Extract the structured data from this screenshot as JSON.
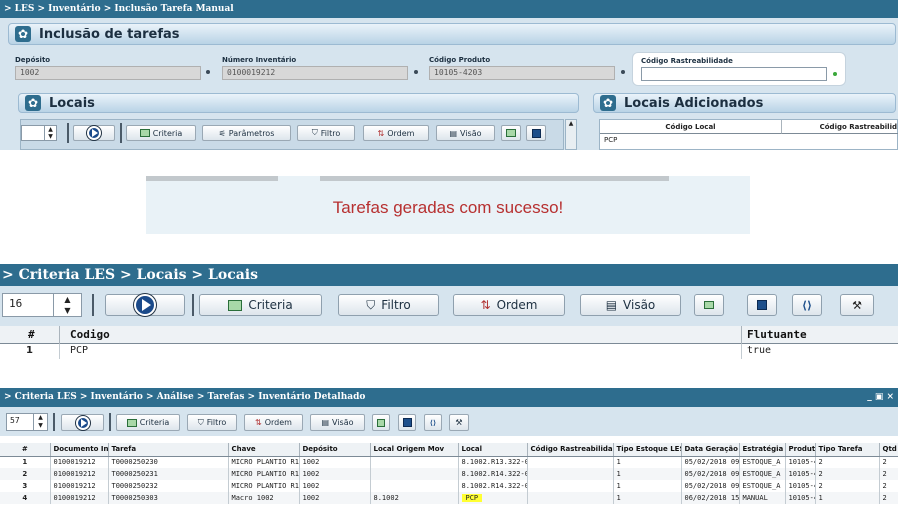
{
  "panel1": {
    "breadcrumb": "> LES > Inventário > Inclusão Tarefa Manual",
    "title": "Inclusão de tarefas",
    "fields": {
      "deposito_label": "Depósito",
      "deposito_value": "1002",
      "numero_label": "Número Inventário",
      "numero_value": "0100019212",
      "produto_label": "Código Produto",
      "produto_value": "10105-4203",
      "rastreabilidade_label": "Código Rastreabilidade",
      "rastreabilidade_value": ""
    },
    "locais_title": "Locais",
    "adicionados_title": "Locais Adicionados",
    "toolbar": {
      "criteria": "Criteria",
      "parametros": "Parâmetros",
      "filtro": "Filtro",
      "ordem": "Ordem",
      "visao": "Visão"
    },
    "adicionados_cols": [
      "Código Local",
      "Código Rastreabilid"
    ],
    "adicionados_rows": [
      "PCP"
    ]
  },
  "message": {
    "text": "Tarefas geradas com sucesso!"
  },
  "panel3": {
    "breadcrumb": "> Criteria LES > Locais > Locais",
    "page_size": "16",
    "toolbar": {
      "criteria": "Criteria",
      "filtro": "Filtro",
      "ordem": "Ordem",
      "visao": "Visão"
    },
    "columns": [
      "#",
      "Codigo",
      "Flutuante"
    ],
    "rows": [
      {
        "num": "1",
        "codigo": "PCP",
        "flutuante": "true"
      }
    ]
  },
  "panel4": {
    "breadcrumb": "> Criteria LES > Inventário > Análise > Tarefas > Inventário Detalhado",
    "window_controls": "_ ▣ ×",
    "page_size": "57",
    "toolbar": {
      "criteria": "Criteria",
      "filtro": "Filtro",
      "ordem": "Ordem",
      "visao": "Visão"
    },
    "columns": [
      "#",
      "Documento In",
      "Tarefa",
      "Chave",
      "Depósito",
      "Local Origem Mov",
      "Local",
      "Código Rastreabilida",
      "Tipo Estoque LES",
      "Data Geração",
      "Estratégia",
      "Produto",
      "Tipo Tarefa",
      "Qtd"
    ],
    "rows": [
      [
        "1",
        "0100019212",
        "T0000250230",
        "MICRO PLANTIO R1",
        "1002",
        "",
        "8.1002.R13.322-0",
        "",
        "1",
        "05/02/2018 09",
        "ESTOQUE_A",
        "10105-420",
        "2",
        "2"
      ],
      [
        "2",
        "0100019212",
        "T0000250231",
        "MICRO PLANTIO R1",
        "1002",
        "",
        "8.1002.R14.322-0",
        "",
        "1",
        "05/02/2018 09",
        "ESTOQUE_A",
        "10105-420",
        "2",
        "2"
      ],
      [
        "3",
        "0100019212",
        "T0000250232",
        "MICRO PLANTIO R1",
        "1002",
        "",
        "8.1002.R14.322-0",
        "",
        "1",
        "05/02/2018 09",
        "ESTOQUE_A",
        "10105-420",
        "2",
        "2"
      ],
      [
        "4",
        "0100019212",
        "T0000250303",
        "Macro 1002",
        "1002",
        "8.1002",
        "PCP",
        "",
        "1",
        "06/02/2018 15",
        "MANUAL",
        "10105-420",
        "1",
        "2"
      ]
    ]
  },
  "colors": {
    "header_bar": "#2e6d8e",
    "panel_bg": "#d6e4ee",
    "message_text": "#b73030",
    "highlight": "#ffff33"
  }
}
